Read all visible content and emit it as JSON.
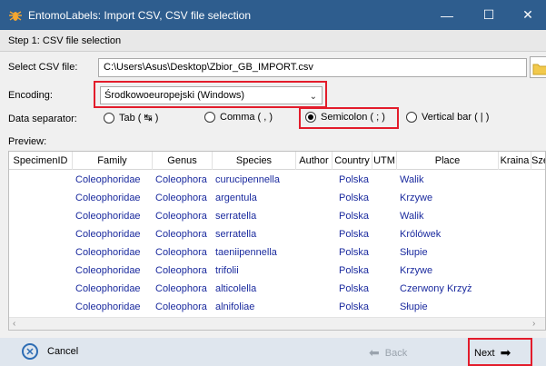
{
  "window": {
    "title": "EntomoLabels: Import CSV, CSV file selection",
    "minimize": "—",
    "maximize": "☐",
    "close": "✕"
  },
  "step": {
    "label": "Step 1: CSV file selection"
  },
  "file": {
    "label": "Select CSV file:",
    "value": "C:\\Users\\Asus\\Desktop\\Zbior_GB_IMPORT.csv"
  },
  "encoding": {
    "label": "Encoding:",
    "value": "Środkowoeuropejski (Windows)"
  },
  "separator": {
    "label": "Data separator:",
    "options": [
      {
        "label": "Tab  ( ↹ )",
        "checked": false
      },
      {
        "label": "Comma  ( , )",
        "checked": false
      },
      {
        "label": "Semicolon  ( ; )",
        "checked": true
      },
      {
        "label": "Vertical bar  ( | )",
        "checked": false
      }
    ]
  },
  "preview": {
    "label": "Preview:",
    "columns": [
      "SpecimenID",
      "Family",
      "Genus",
      "Species",
      "Author",
      "Country",
      "UTM",
      "Place",
      "Kraina",
      "Szerc"
    ],
    "rows": [
      [
        "",
        "Coleophoridae",
        "Coleophora",
        "curucipennella",
        "",
        "Polska",
        "",
        "Walik",
        "",
        ""
      ],
      [
        "",
        "Coleophoridae",
        "Coleophora",
        "argentula",
        "",
        "Polska",
        "",
        "Krzywe",
        "",
        ""
      ],
      [
        "",
        "Coleophoridae",
        "Coleophora",
        "serratella",
        "",
        "Polska",
        "",
        "Walik",
        "",
        ""
      ],
      [
        "",
        "Coleophoridae",
        "Coleophora",
        "serratella",
        "",
        "Polska",
        "",
        "Królówek",
        "",
        ""
      ],
      [
        "",
        "Coleophoridae",
        "Coleophora",
        "taeniipennella",
        "",
        "Polska",
        "",
        "Słupie",
        "",
        ""
      ],
      [
        "",
        "Coleophoridae",
        "Coleophora",
        "trifolii",
        "",
        "Polska",
        "",
        "Krzywe",
        "",
        ""
      ],
      [
        "",
        "Coleophoridae",
        "Coleophora",
        "alticolella",
        "",
        "Polska",
        "",
        "Czerwony Krzyż",
        "",
        ""
      ],
      [
        "",
        "Coleophoridae",
        "Coleophora",
        "alnifoliae",
        "",
        "Polska",
        "",
        "Słupie",
        "",
        ""
      ]
    ]
  },
  "footer": {
    "cancel": "Cancel",
    "back": "Back",
    "next": "Next"
  },
  "colors": {
    "titlebar": "#2e5d8e",
    "highlight": "#e31c2b",
    "cell_text": "#1a2a9e"
  }
}
